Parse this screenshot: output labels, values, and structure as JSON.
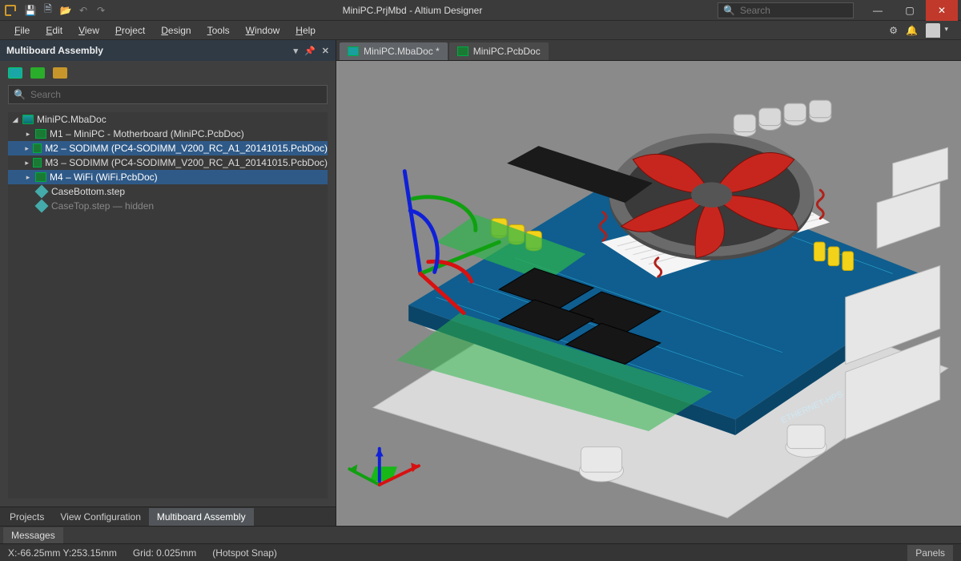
{
  "app": {
    "title": "MiniPC.PrjMbd - Altium Designer",
    "search_placeholder": "Search"
  },
  "menu": {
    "file": "File",
    "edit": "Edit",
    "view": "View",
    "project": "Project",
    "design": "Design",
    "tools": "Tools",
    "window": "Window",
    "help": "Help"
  },
  "panel": {
    "title": "Multiboard Assembly",
    "search_placeholder": "Search",
    "root": "MiniPC.MbaDoc",
    "items": [
      {
        "label": "M1 – MiniPC - Motherboard (MiniPC.PcbDoc)",
        "selected": false,
        "kind": "pcb"
      },
      {
        "label": "M2 – SODIMM (PC4-SODIMM_V200_RC_A1_20141015.PcbDoc)",
        "selected": true,
        "kind": "pcb"
      },
      {
        "label": "M3 – SODIMM (PC4-SODIMM_V200_RC_A1_20141015.PcbDoc)",
        "selected": false,
        "kind": "pcb"
      },
      {
        "label": "M4 – WiFi (WiFi.PcbDoc)",
        "selected": true,
        "kind": "pcb"
      },
      {
        "label": "CaseBottom.step",
        "selected": false,
        "kind": "step"
      },
      {
        "label": "CaseTop.step — hidden",
        "selected": false,
        "kind": "step",
        "muted": true
      }
    ],
    "tabs": [
      "Projects",
      "View Configuration",
      "Multiboard Assembly"
    ],
    "active_tab_index": 2
  },
  "editor": {
    "tabs": [
      {
        "label": "MiniPC.MbaDoc *",
        "icon": "mba",
        "active": true
      },
      {
        "label": "MiniPC.PcbDoc",
        "icon": "pcb",
        "active": false
      }
    ]
  },
  "status": {
    "messages_label": "Messages",
    "coords": "X:-66.25mm Y:253.15mm",
    "grid": "Grid: 0.025mm",
    "snap": "(Hotspot Snap)",
    "panels_label": "Panels"
  },
  "viewport": {
    "pcb_label": "ETHERNET-HPS"
  }
}
